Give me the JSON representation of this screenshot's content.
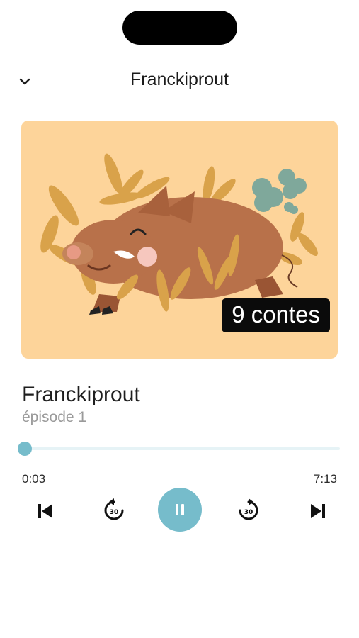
{
  "header": {
    "title": "Franckiprout",
    "back_icon": "chevron-down-icon"
  },
  "artwork": {
    "badge": "9 contes",
    "background": "#fdd49a"
  },
  "track": {
    "title": "Franckiprout",
    "subtitle": "épisode 1"
  },
  "player": {
    "current_time": "0:03",
    "total_time": "7:13",
    "progress_fraction": 0.007,
    "rewind_seconds": "30",
    "forward_seconds": "30",
    "state_icon": "pause-icon",
    "accent": "#76bccb"
  }
}
